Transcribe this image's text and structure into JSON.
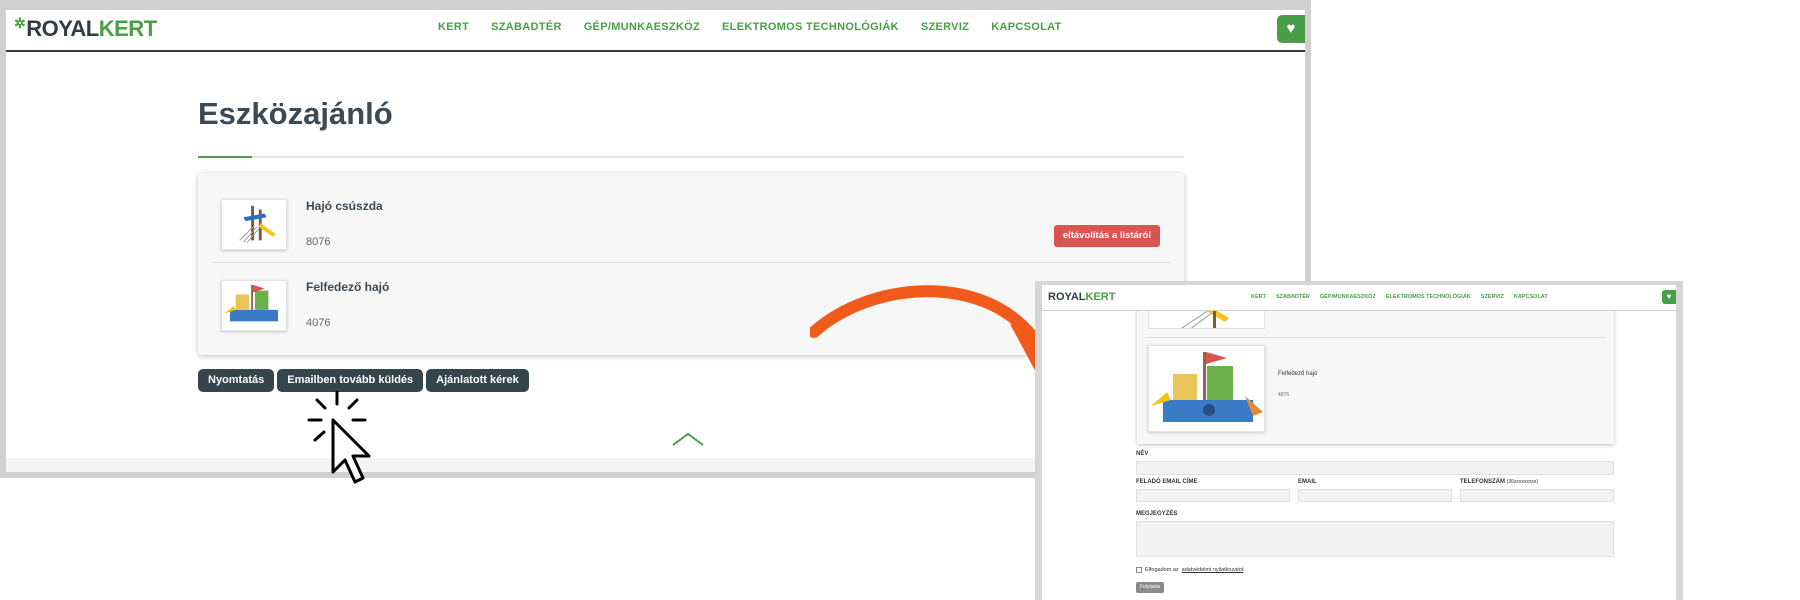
{
  "brand": {
    "logo_royal": "ROYAL",
    "logo_kert": "KERT"
  },
  "nav": {
    "items": [
      "KERT",
      "SZABADTÉR",
      "GÉP/MUNKAESZKÖZ",
      "ELEKTROMOS TECHNOLÓGIÁK",
      "SZERVIZ",
      "KAPCSOLAT"
    ],
    "heart_icon": "heart-icon"
  },
  "page": {
    "title": "Eszközajánló"
  },
  "list": {
    "items": [
      {
        "name": "Hajó csúszda",
        "code": "8076",
        "remove_label": "eltávolítás a listáról"
      },
      {
        "name": "Felfedező hajó",
        "code": "4076"
      }
    ]
  },
  "actions": {
    "print": "Nyomtatás",
    "email_forward": "Emailben tovább küldés",
    "request_quote": "Ajánlatott kérek"
  },
  "zoom": {
    "item_name": "Felfedező hajó",
    "item_code": "4076",
    "form": {
      "name_label": "NÉV",
      "sender_email_label": "FELADÓ EMAIL CÍME",
      "email_label": "EMAIL",
      "phone_label": "TELEFONSZÁM",
      "phone_hint": "(36xxxxxxxxx)",
      "note_label": "MEGJEGYZÉS",
      "consent_text": "Elfogadom az",
      "consent_link": "adatvédelmi nyilatkozatot",
      "submit_label": "Folytatás"
    }
  },
  "colors": {
    "brand_green": "#4a9e48",
    "dark_slate": "#34454e",
    "danger_red": "#d9534f",
    "arrow_orange": "#f05a1a"
  }
}
